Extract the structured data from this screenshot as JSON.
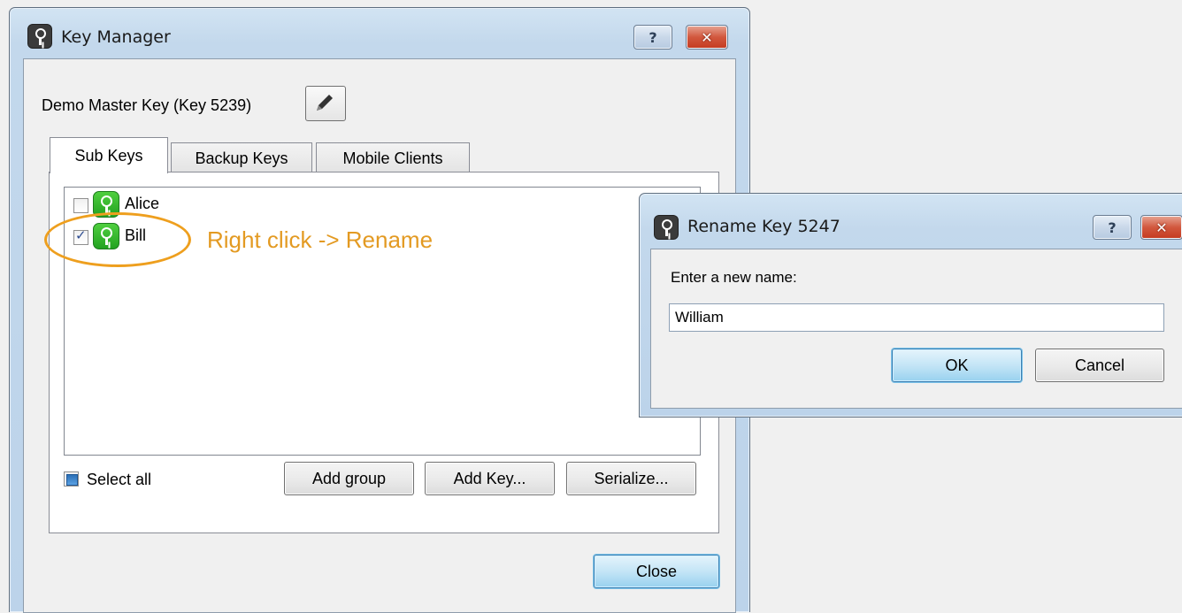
{
  "key_manager": {
    "title": "Key Manager",
    "help_glyph": "?",
    "close_glyph": "✕",
    "master_key_label": "Demo Master Key (Key 5239)",
    "tabs": [
      {
        "label": "Sub Keys",
        "active": true
      },
      {
        "label": "Backup Keys",
        "active": false
      },
      {
        "label": "Mobile Clients",
        "active": false
      }
    ],
    "keys": [
      {
        "name": "Alice",
        "checked": false,
        "icon": "key-icon"
      },
      {
        "name": "Bill",
        "checked": true,
        "icon": "key-icon"
      }
    ],
    "select_all_label": "Select all",
    "add_group_label": "Add group",
    "add_key_label": "Add Key...",
    "serialize_label": "Serialize...",
    "close_label": "Close"
  },
  "annotation": {
    "text": "Right click -> Rename",
    "color": "#e39a22"
  },
  "rename_dialog": {
    "title": "Rename Key 5247",
    "help_glyph": "?",
    "close_glyph": "✕",
    "prompt": "Enter a new name:",
    "value": "William",
    "ok_label": "OK",
    "cancel_label": "Cancel"
  }
}
